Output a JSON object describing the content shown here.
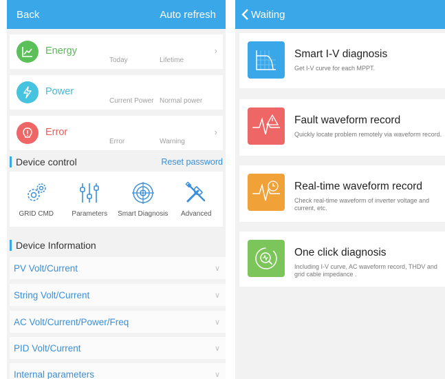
{
  "left": {
    "header": {
      "back": "Back",
      "auto_refresh": "Auto refresh"
    },
    "summary": [
      {
        "title": "Energy",
        "sub1": "Today",
        "sub2": "Lifetime",
        "color": "#5cc05a",
        "title_color": "#5cb85c",
        "icon": "chart-icon"
      },
      {
        "title": "Power",
        "sub1": "Current Power",
        "sub2": "Normal power",
        "color": "#46c3de",
        "title_color": "#46b8da",
        "icon": "lightning-icon"
      },
      {
        "title": "Error",
        "sub1": "Error",
        "sub2": "Warning",
        "color": "#ee6666",
        "title_color": "#e85c5c",
        "icon": "warning-icon"
      }
    ],
    "device_control": {
      "heading": "Device control",
      "reset_password": "Reset password",
      "items": [
        {
          "label": "GRID CMD",
          "icon": "gears-icon"
        },
        {
          "label": "Parameters",
          "icon": "sliders-icon"
        },
        {
          "label": "Smart Diagnosis",
          "icon": "target-icon"
        },
        {
          "label": "Advanced",
          "icon": "tools-icon"
        }
      ]
    },
    "device_information": {
      "heading": "Device Information",
      "rows": [
        "PV Volt/Current",
        "String Volt/Current",
        "AC Volt/Current/Power/Freq",
        "PID Volt/Current",
        "Internal parameters"
      ]
    }
  },
  "right": {
    "header": {
      "back": "Waiting"
    },
    "items": [
      {
        "title": "Smart I-V diagnosis",
        "desc": "Get I-V curve for each MPPT.",
        "color": "#3aa8e8",
        "icon": "iv-curve-icon"
      },
      {
        "title": "Fault waveform record",
        "desc": "Quickly locate problem remotely via waveform record.",
        "color": "#ee6666",
        "icon": "fault-waveform-icon"
      },
      {
        "title": "Real-time waveform record",
        "desc": "Check real-time waveform of inverter voltage and current, etc.",
        "color": "#f0a238",
        "icon": "realtime-waveform-icon"
      },
      {
        "title": "One click diagnosis",
        "desc": "Including I-V curve, AC waveform record, THDV and grid cable impedance .",
        "color": "#7cc55a",
        "icon": "one-click-diagnosis-icon"
      }
    ]
  }
}
